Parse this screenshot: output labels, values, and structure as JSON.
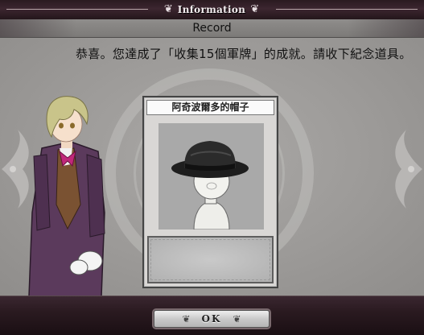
{
  "header": {
    "title": "Information",
    "left_ornament_icon": "scroll-ornament-icon",
    "right_ornament_icon": "scroll-ornament-icon"
  },
  "record_bar": {
    "title": "Record"
  },
  "dialog": {
    "message": "恭喜。您達成了「收集15個軍牌」的成就。請收下紀念道具。"
  },
  "reward_card": {
    "item_name": "阿奇波爾多的帽子"
  },
  "footer": {
    "ok_label": "OK",
    "ok_icon": "ornament-icon"
  },
  "colors": {
    "frame": "#2a1a20",
    "panel": "#9c9a98",
    "card_bg": "#d9d7d5",
    "item_bg": "#a9a9a9"
  }
}
